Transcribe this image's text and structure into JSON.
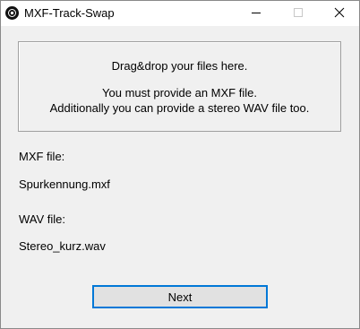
{
  "window": {
    "title": "MXF-Track-Swap",
    "controls": {
      "minimize_icon": "minimize-icon",
      "maximize_icon": "maximize-icon",
      "close_icon": "close-icon"
    },
    "app_icon": "app-icon"
  },
  "drop_zone": {
    "line1": "Drag&drop your files here.",
    "line2": "You must provide an MXF file.",
    "line3": "Additionally you can provide a stereo WAV file too."
  },
  "mxf": {
    "label": "MXF file:",
    "value": "Spurkennung.mxf"
  },
  "wav": {
    "label": "WAV file:",
    "value": "Stereo_kurz.wav"
  },
  "actions": {
    "next_label": "Next"
  },
  "colors": {
    "window_bg": "#f0f0f0",
    "titlebar_bg": "#ffffff",
    "button_bg": "#e1e1e1",
    "focus_border": "#0078d7"
  }
}
